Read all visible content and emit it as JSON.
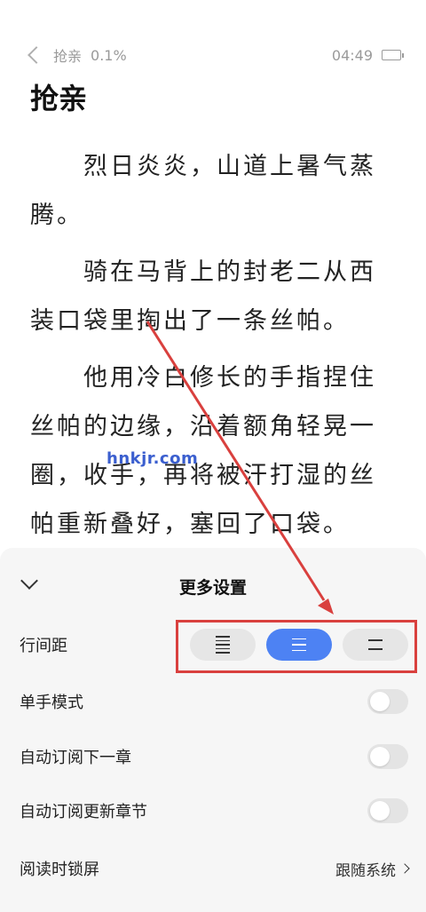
{
  "status_bar": {
    "back_icon": "chevron-left-icon",
    "book_name": "抢亲",
    "progress": "0.1%",
    "time": "04:49",
    "battery_level": 0.8
  },
  "chapter": {
    "title": "抢亲",
    "paragraphs": [
      "烈日炎炎，山道上暑气蒸腾。",
      "骑在马背上的封老二从西装口袋里掏出了一条丝帕。",
      "他用冷白修长的手指捏住丝帕的边缘，沿着额角轻晃一圈，收手，再将被汗打湿的丝帕重新叠好，塞回了口袋。"
    ]
  },
  "watermark": "hnkjr.com",
  "settings_panel": {
    "title": "更多设置",
    "collapse_icon": "chevron-down-icon",
    "line_spacing": {
      "label": "行间距",
      "options": [
        "dense-lines-icon",
        "medium-lines-icon",
        "sparse-lines-icon"
      ],
      "selected_index": 1
    },
    "one_hand_mode": {
      "label": "单手模式",
      "on": false
    },
    "auto_subscribe_next": {
      "label": "自动订阅下一章",
      "on": false
    },
    "auto_subscribe_updates": {
      "label": "自动订阅更新章节",
      "on": false
    },
    "screen_lock": {
      "label": "阅读时锁屏",
      "value": "跟随系统"
    }
  },
  "colors": {
    "accent": "#4d82f3",
    "annotation_red": "#d9403e",
    "panel_bg": "#f6f6f6"
  }
}
